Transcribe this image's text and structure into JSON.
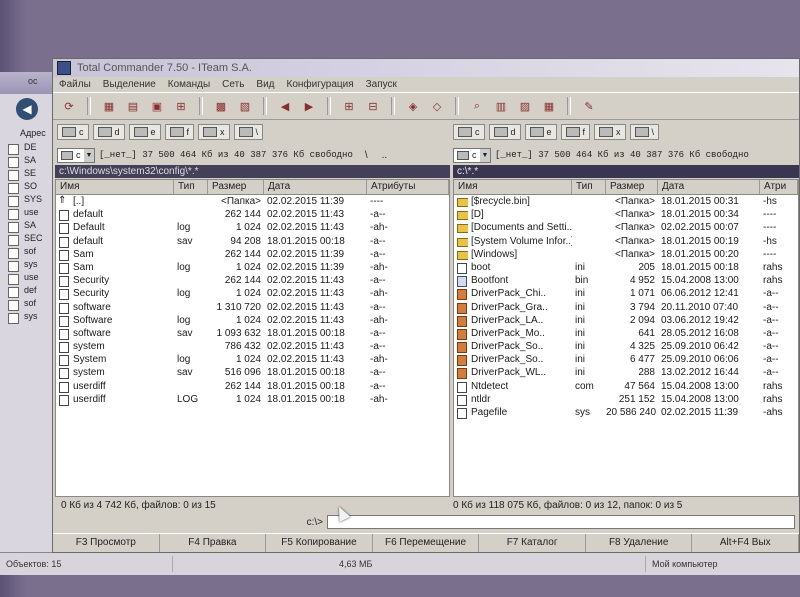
{
  "window": {
    "title": "Total Commander 7.50 - ITeam S.A."
  },
  "menu": [
    "Файлы",
    "Выделение",
    "Команды",
    "Сеть",
    "Вид",
    "Конфигурация",
    "Запуск"
  ],
  "left": {
    "drives": [
      "c",
      "d",
      "e",
      "f",
      "x",
      "\\"
    ],
    "drive_combo": "c",
    "drive_info": "[_нет_]  37 500 464 Кб из 40 387 376 Кб свободно",
    "path": "c:\\Windows\\system32\\config\\*.*",
    "columns": {
      "name": "Имя",
      "ext": "Тип",
      "size": "Размер",
      "date": "Дата",
      "attr": "Атрибуты"
    },
    "rows": [
      {
        "icon": "up",
        "name": "[..]",
        "ext": "",
        "size": "<Папка>",
        "date": "02.02.2015 11:39",
        "attr": "----"
      },
      {
        "icon": "file",
        "name": "default",
        "ext": "",
        "size": "262 144",
        "date": "02.02.2015 11:43",
        "attr": "-a--"
      },
      {
        "icon": "file",
        "name": "Default",
        "ext": "log",
        "size": "1 024",
        "date": "02.02.2015 11:43",
        "attr": "-ah-"
      },
      {
        "icon": "file",
        "name": "default",
        "ext": "sav",
        "size": "94 208",
        "date": "18.01.2015 00:18",
        "attr": "-a--"
      },
      {
        "icon": "file",
        "name": "Sam",
        "ext": "",
        "size": "262 144",
        "date": "02.02.2015 11:39",
        "attr": "-a--"
      },
      {
        "icon": "file",
        "name": "Sam",
        "ext": "log",
        "size": "1 024",
        "date": "02.02.2015 11:39",
        "attr": "-ah-"
      },
      {
        "icon": "file",
        "name": "Security",
        "ext": "",
        "size": "262 144",
        "date": "02.02.2015 11:43",
        "attr": "-a--"
      },
      {
        "icon": "file",
        "name": "Security",
        "ext": "log",
        "size": "1 024",
        "date": "02.02.2015 11:43",
        "attr": "-ah-"
      },
      {
        "icon": "file",
        "name": "software",
        "ext": "",
        "size": "1 310 720",
        "date": "02.02.2015 11:43",
        "attr": "-a--"
      },
      {
        "icon": "file",
        "name": "Software",
        "ext": "log",
        "size": "1 024",
        "date": "02.02.2015 11:43",
        "attr": "-ah-"
      },
      {
        "icon": "file",
        "name": "software",
        "ext": "sav",
        "size": "1 093 632",
        "date": "18.01.2015 00:18",
        "attr": "-a--"
      },
      {
        "icon": "file",
        "name": "system",
        "ext": "",
        "size": "786 432",
        "date": "02.02.2015 11:43",
        "attr": "-a--"
      },
      {
        "icon": "file",
        "name": "System",
        "ext": "log",
        "size": "1 024",
        "date": "02.02.2015 11:43",
        "attr": "-ah-"
      },
      {
        "icon": "file",
        "name": "system",
        "ext": "sav",
        "size": "516 096",
        "date": "18.01.2015 00:18",
        "attr": "-a--"
      },
      {
        "icon": "file",
        "name": "userdiff",
        "ext": "",
        "size": "262 144",
        "date": "18.01.2015 00:18",
        "attr": "-a--"
      },
      {
        "icon": "file",
        "name": "userdiff",
        "ext": "LOG",
        "size": "1 024",
        "date": "18.01.2015 00:18",
        "attr": "-ah-"
      }
    ],
    "status": "0 Кб из 4 742 Кб, файлов: 0 из 15"
  },
  "right": {
    "drives": [
      "c",
      "d",
      "e",
      "f",
      "x",
      "\\"
    ],
    "drive_combo": "c",
    "drive_info": "[_нет_]  37 500 464 Кб из 40 387 376 Кб свободно",
    "path": "c:\\*.*",
    "columns": {
      "name": "Имя",
      "ext": "Тип",
      "size": "Размер",
      "date": "Дата",
      "attr": "Атри"
    },
    "rows": [
      {
        "icon": "folder",
        "name": "[$recycle.bin]",
        "ext": "",
        "size": "<Папка>",
        "date": "18.01.2015 00:31",
        "attr": "-hs"
      },
      {
        "icon": "folder",
        "name": "[D]",
        "ext": "",
        "size": "<Папка>",
        "date": "18.01.2015 00:34",
        "attr": "----"
      },
      {
        "icon": "folder",
        "name": "[Documents and Setti..]",
        "ext": "",
        "size": "<Папка>",
        "date": "02.02.2015 00:07",
        "attr": "----"
      },
      {
        "icon": "folder",
        "name": "[System Volume Infor..]",
        "ext": "",
        "size": "<Папка>",
        "date": "18.01.2015 00:19",
        "attr": "-hs"
      },
      {
        "icon": "folder",
        "name": "[Windows]",
        "ext": "",
        "size": "<Папка>",
        "date": "18.01.2015 00:20",
        "attr": "----"
      },
      {
        "icon": "file",
        "name": "boot",
        "ext": "ini",
        "size": "205",
        "date": "18.01.2015 00:18",
        "attr": "rahs"
      },
      {
        "icon": "app",
        "name": "Bootfont",
        "ext": "bin",
        "size": "4 952",
        "date": "15.04.2008 13:00",
        "attr": "rahs"
      },
      {
        "icon": "pack",
        "name": "DriverPack_Chi..",
        "ext": "ini",
        "size": "1 071",
        "date": "06.06.2012 12:41",
        "attr": "-a--"
      },
      {
        "icon": "pack",
        "name": "DriverPack_Gra..",
        "ext": "ini",
        "size": "3 794",
        "date": "20.11.2010 07:40",
        "attr": "-a--"
      },
      {
        "icon": "pack",
        "name": "DriverPack_LA..",
        "ext": "ini",
        "size": "2 094",
        "date": "03.06.2012 19:42",
        "attr": "-a--"
      },
      {
        "icon": "pack",
        "name": "DriverPack_Mo..",
        "ext": "ini",
        "size": "641",
        "date": "28.05.2012 16:08",
        "attr": "-a--"
      },
      {
        "icon": "pack",
        "name": "DriverPack_So..",
        "ext": "ini",
        "size": "4 325",
        "date": "25.09.2010 06:42",
        "attr": "-a--"
      },
      {
        "icon": "pack",
        "name": "DriverPack_So..",
        "ext": "ini",
        "size": "6 477",
        "date": "25.09.2010 06:06",
        "attr": "-a--"
      },
      {
        "icon": "pack",
        "name": "DriverPack_WL..",
        "ext": "ini",
        "size": "288",
        "date": "13.02.2012 16:44",
        "attr": "-a--"
      },
      {
        "icon": "file",
        "name": "Ntdetect",
        "ext": "com",
        "size": "47 564",
        "date": "15.04.2008 13:00",
        "attr": "rahs"
      },
      {
        "icon": "file",
        "name": "ntldr",
        "ext": "",
        "size": "251 152",
        "date": "15.04.2008 13:00",
        "attr": "rahs"
      },
      {
        "icon": "file",
        "name": "Pagefile",
        "ext": "sys",
        "size": "20 586 240",
        "date": "02.02.2015 11:39",
        "attr": "-ahs"
      }
    ],
    "status": "0 Кб из 118 075 Кб, файлов: 0 из 12, папок: 0 из 5"
  },
  "cmdline": {
    "label": "c:\\>"
  },
  "fkeys": [
    "F3 Просмотр",
    "F4 Правка",
    "F5 Копирование",
    "F6 Перемещение",
    "F7 Каталог",
    "F8 Удаление",
    "Alt+F4 Вых"
  ],
  "background": {
    "explorer_title": "ос",
    "address_label": "Адрес",
    "list": [
      "DE",
      "SA",
      "SE",
      "SO",
      "SYS",
      "use",
      "SA",
      "SEC",
      "sof",
      "sys",
      "use",
      "def",
      "sof",
      "sys"
    ],
    "status": {
      "objects": "Объектов: 15",
      "size": "4,63 МБ",
      "location": "Мой компьютер"
    }
  }
}
